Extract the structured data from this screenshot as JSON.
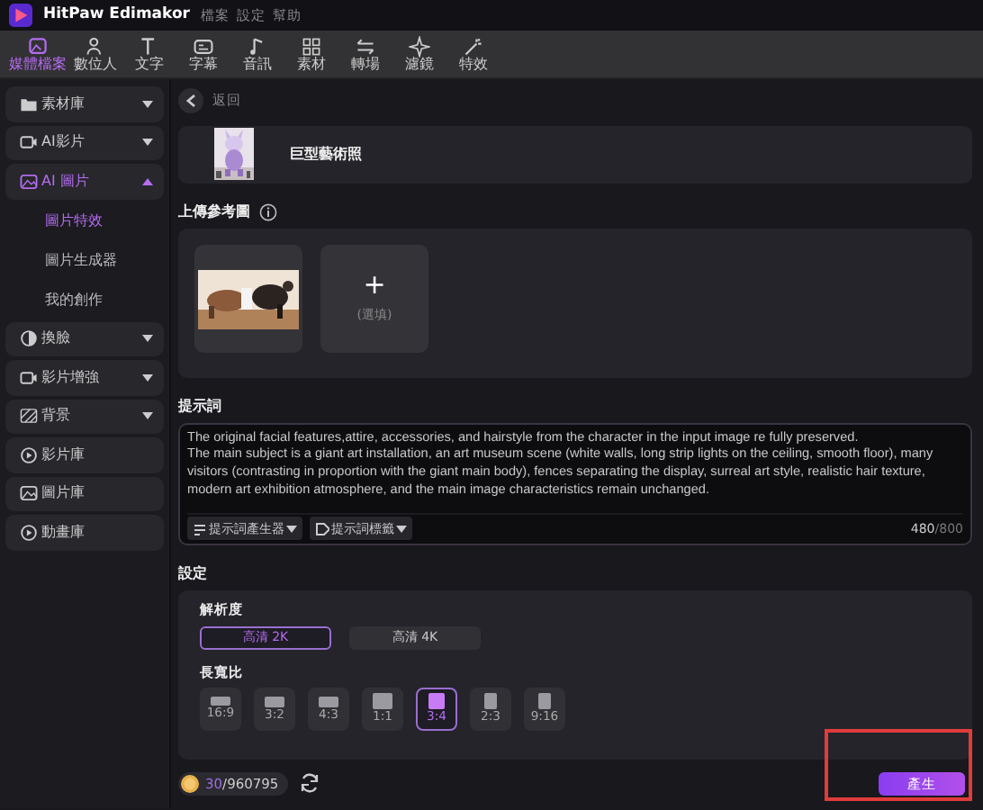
{
  "window": {
    "title": "HitPaw Edimakor",
    "menu": [
      "檔案",
      "設定",
      "幫助"
    ]
  },
  "toolbar": [
    {
      "label": "媒體檔案",
      "selected": true
    },
    {
      "label": "數位人",
      "selected": false
    },
    {
      "label": "文字",
      "selected": false
    },
    {
      "label": "字幕",
      "selected": false
    },
    {
      "label": "音訊",
      "selected": false
    },
    {
      "label": "素材",
      "selected": false
    },
    {
      "label": "轉場",
      "selected": false
    },
    {
      "label": "濾鏡",
      "selected": false
    },
    {
      "label": "特效",
      "selected": false
    }
  ],
  "sidebar": {
    "items": [
      {
        "label": "素材庫",
        "selected": false,
        "expanded": false
      },
      {
        "label": "AI影片",
        "selected": false,
        "expanded": false
      },
      {
        "label": "AI 圖片",
        "selected": true,
        "expanded": true,
        "children": [
          {
            "label": "圖片特效",
            "selected": true
          },
          {
            "label": "圖片生成器",
            "selected": false
          },
          {
            "label": "我的創作",
            "selected": false
          }
        ]
      },
      {
        "label": "換臉",
        "selected": false,
        "expanded": false
      },
      {
        "label": "影片增強",
        "selected": false,
        "expanded": false
      },
      {
        "label": "背景",
        "selected": false,
        "expanded": false
      },
      {
        "label": "影片庫",
        "selected": false
      },
      {
        "label": "圖片庫",
        "selected": false
      },
      {
        "label": "動畫庫",
        "selected": false
      }
    ]
  },
  "main": {
    "back": "返回",
    "effect": {
      "title": "巨型藝術照"
    },
    "upload": {
      "title": "上傳參考圖",
      "add_hint": "(選填)",
      "add_symbol": "+"
    },
    "prompt": {
      "title": "提示詞",
      "value": "The original facial features,attire, accessories, and hairstyle from the character in the input image re fully preserved.\nThe main subject is a giant art installation, an art museum scene (white walls, long strip lights on the ceiling, smooth floor), many visitors (contrasting in proportion with the giant main body), fences separating the display, surreal art style, realistic hair texture, modern art exhibition atmosphere, and the main image characteristics remain unchanged.",
      "buttons": [
        "提示詞產生器",
        "提示詞標籤"
      ],
      "count": "480",
      "max": "/800"
    },
    "settings": {
      "title": "設定",
      "resolution_title": "解析度",
      "resolutions": [
        {
          "label": "高清 2K",
          "selected": true
        },
        {
          "label": "高清 4K",
          "selected": false
        }
      ],
      "ratio_title": "長寬比",
      "ratios": [
        {
          "label": "16:9",
          "selected": false
        },
        {
          "label": "3:2",
          "selected": false
        },
        {
          "label": "4:3",
          "selected": false
        },
        {
          "label": "1:1",
          "selected": false
        },
        {
          "label": "3:4",
          "selected": true
        },
        {
          "label": "2:3",
          "selected": false
        },
        {
          "label": "9:16",
          "selected": false
        }
      ]
    },
    "credits": {
      "cost": "30",
      "total": "/960795"
    },
    "generate": {
      "label": "產生",
      "highlighted": true
    }
  }
}
